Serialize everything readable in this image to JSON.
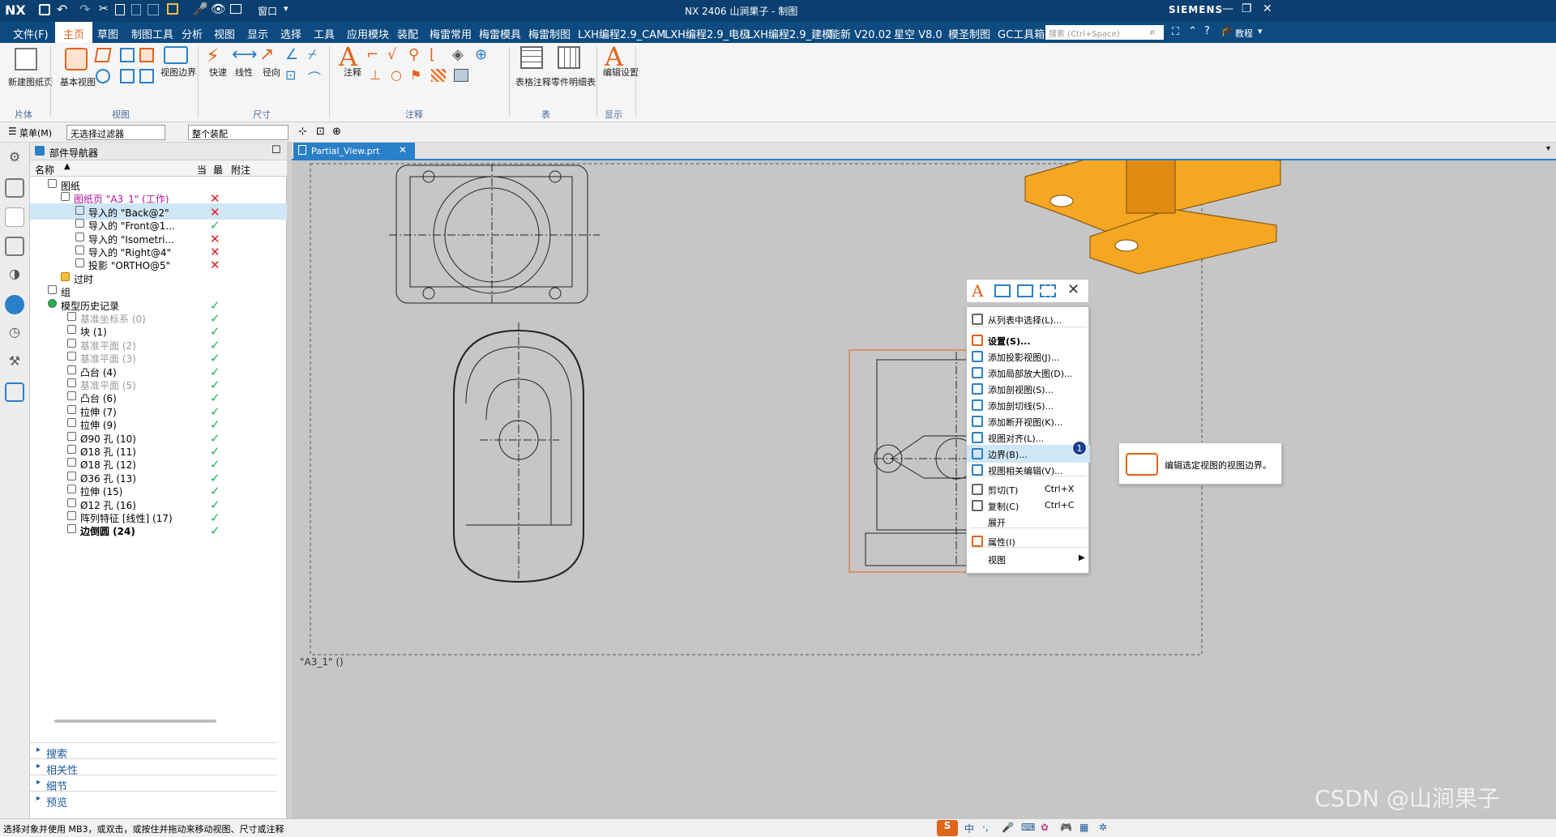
{
  "titlebar": {
    "logo": "NX",
    "quick_access": [
      "保存",
      "撤消",
      "重做",
      "剪切",
      "复制",
      "粘贴",
      "窗口"
    ],
    "window_menu": "窗口",
    "title": "NX 2406 山涧果子 - 制图",
    "brand": "SIEMENS"
  },
  "menubar": {
    "file": "文件(F)",
    "tabs": [
      "主页",
      "草图",
      "制图工具",
      "分析",
      "视图",
      "显示",
      "选择",
      "工具",
      "应用模块",
      "装配",
      "梅雷常用",
      "梅雷模具",
      "梅雷制图",
      "LXH编程2.9_CAM",
      "LXH编程2.9_电极",
      "LXH编程2.9_建模",
      "能新 V20.02",
      "星空 V8.0",
      "模圣制图",
      "GC工具箱"
    ],
    "active_tab": "主页",
    "search_placeholder": "搜索 (Ctrl+Space)",
    "tutorial": "教程"
  },
  "ribbon": {
    "new_sheet": "新建图纸页",
    "base_view": "基本视图",
    "view_boundary": "视图边界",
    "rapid_dim": "快速",
    "linear_dim": "线性",
    "radial_dim": "径向",
    "note": "注释",
    "table_note": "表格注释",
    "parts_list": "零件明细表",
    "edit_settings": "编辑设置",
    "groups": [
      "片体",
      "视图",
      "尺寸",
      "注释",
      "表",
      "显示"
    ]
  },
  "selbar": {
    "menu": "菜单(M)",
    "filter": "无选择过滤器",
    "scope": "整个装配"
  },
  "navigator": {
    "title": "部件导航器",
    "columns": [
      "名称",
      "当",
      "最",
      "附注"
    ],
    "rows": [
      {
        "label": "图纸",
        "status": ""
      },
      {
        "label": "图纸页 \"A3_1\" (工作)",
        "status": "bad"
      },
      {
        "label": "导入的 \"Back@2\"",
        "status": "bad"
      },
      {
        "label": "导入的 \"Front@1...",
        "status": "ok"
      },
      {
        "label": "导入的 \"Isometri...",
        "status": "bad"
      },
      {
        "label": "导入的 \"Right@4\"",
        "status": "bad"
      },
      {
        "label": "投影 \"ORTHO@5\"",
        "status": "bad"
      },
      {
        "label": "过时",
        "status": ""
      },
      {
        "label": "组",
        "status": ""
      },
      {
        "label": "模型历史记录",
        "status": "ok"
      },
      {
        "label": "基准坐标系 (0)",
        "status": "ok"
      },
      {
        "label": "块 (1)",
        "status": "ok"
      },
      {
        "label": "基准平面 (2)",
        "status": "ok"
      },
      {
        "label": "基准平面 (3)",
        "status": "ok"
      },
      {
        "label": "凸台 (4)",
        "status": "ok"
      },
      {
        "label": "基准平面 (5)",
        "status": "ok"
      },
      {
        "label": "凸台 (6)",
        "status": "ok"
      },
      {
        "label": "拉伸 (7)",
        "status": "ok"
      },
      {
        "label": "拉伸 (9)",
        "status": "ok"
      },
      {
        "label": "Ø90 孔 (10)",
        "status": "ok"
      },
      {
        "label": "Ø18 孔 (11)",
        "status": "ok"
      },
      {
        "label": "Ø18 孔 (12)",
        "status": "ok"
      },
      {
        "label": "Ø36 孔 (13)",
        "status": "ok"
      },
      {
        "label": "拉伸 (15)",
        "status": "ok"
      },
      {
        "label": "Ø12 孔 (16)",
        "status": "ok"
      },
      {
        "label": "阵列特征 [线性] (17)",
        "status": "ok"
      },
      {
        "label": "边倒圆 (24)",
        "status": "ok"
      }
    ],
    "panels": [
      "搜索",
      "相关性",
      "细节",
      "预览"
    ]
  },
  "graphics": {
    "tab": "Partial_View.prt",
    "sheet_label": "\"A3_1\"  ()"
  },
  "context_menu": {
    "items": [
      {
        "label": "从列表中选择(L)...",
        "shortcut": ""
      },
      {
        "label": "设置(S)...",
        "shortcut": ""
      },
      {
        "label": "添加投影视图(J)...",
        "shortcut": ""
      },
      {
        "label": "添加局部放大图(D)...",
        "shortcut": ""
      },
      {
        "label": "添加剖视图(S)...",
        "shortcut": ""
      },
      {
        "label": "添加剖切线(S)...",
        "shortcut": ""
      },
      {
        "label": "添加断开视图(K)...",
        "shortcut": ""
      },
      {
        "label": "视图对齐(L)...",
        "shortcut": ""
      },
      {
        "label": "边界(B)...",
        "shortcut": ""
      },
      {
        "label": "视图相关编辑(V)...",
        "shortcut": ""
      },
      {
        "label": "剪切(T)",
        "shortcut": "Ctrl+X"
      },
      {
        "label": "复制(C)",
        "shortcut": "Ctrl+C"
      },
      {
        "label": "展开",
        "shortcut": ""
      },
      {
        "label": "属性(I)",
        "shortcut": ""
      },
      {
        "label": "视图",
        "shortcut": ""
      }
    ],
    "badge": "1",
    "tooltip": "编辑选定视图的视图边界。"
  },
  "statusbar": {
    "message": "选择对象并使用 MB3，或双击，或按住并拖动来移动视图、尺寸或注释",
    "ime": "中"
  },
  "watermark": "CSDN @山涧果子",
  "colors": {
    "titlebar": "#0a3f6f",
    "accent_orange": "#f5a623",
    "check_green": "#1fb34a",
    "cross_red": "#e01a22"
  }
}
